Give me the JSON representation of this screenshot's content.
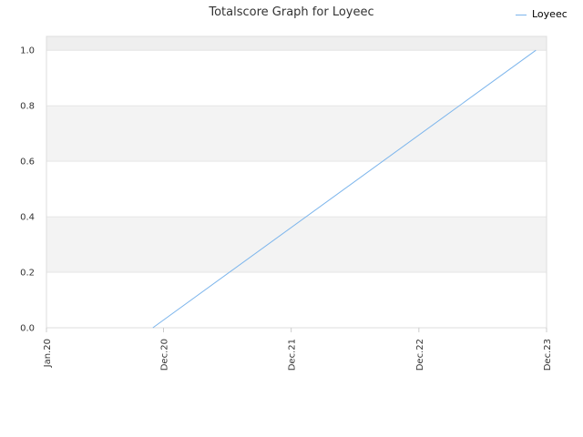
{
  "chart_data": {
    "type": "line",
    "title": "Totalscore Graph for Loyeec",
    "xlabel": "",
    "ylabel": "",
    "x_ticks": [
      "Jan.20",
      "Dec.20",
      "Dec.21",
      "Dec.22",
      "Dec.23"
    ],
    "ylim": [
      0,
      1.05
    ],
    "y_ticks": [
      "0.0",
      "0.2",
      "0.4",
      "0.6",
      "0.8",
      "1.0"
    ],
    "legend_position": "top-right",
    "grid": "alternating horizontal bands",
    "series": [
      {
        "name": "Loyeec",
        "color": "#7cb5ec",
        "points": [
          {
            "x": "2020-11",
            "y": 0.0
          },
          {
            "x": "2023-11",
            "y": 1.0
          }
        ]
      }
    ]
  }
}
